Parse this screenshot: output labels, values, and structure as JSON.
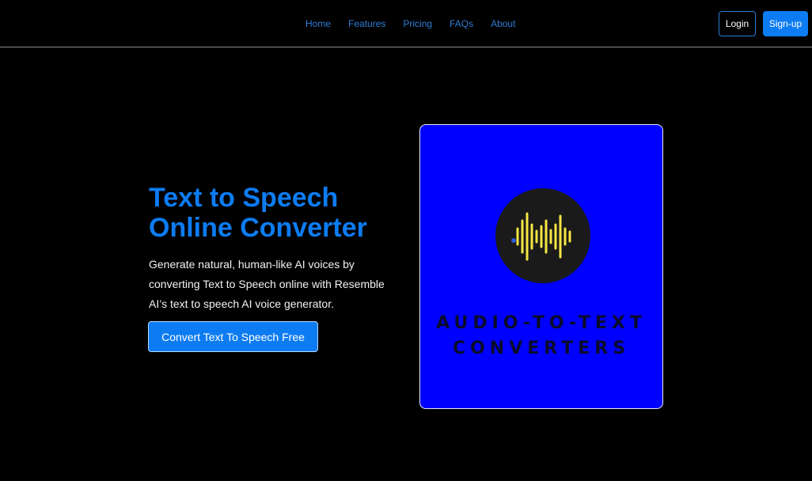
{
  "nav": {
    "links": [
      "Home",
      "Features",
      "Pricing",
      "FAQs",
      "About"
    ],
    "login_label": "Login",
    "signup_label": "Sign-up"
  },
  "hero": {
    "title_line1": "Text to Speech",
    "title_line2": "Online Converter",
    "description": "Generate natural, human-like AI voices by converting Text to Speech online with Resemble AI’s text to speech AI voice generator.",
    "cta_label": "Convert Text To Speech Free"
  },
  "logo": {
    "line1": "AUDIO-TO-TEXT",
    "line2": "CONVERTERS",
    "icon": "sound-wave-icon"
  },
  "colors": {
    "background": "#000000",
    "accent": "#0d7cf2",
    "nav_link": "#2f7dd6",
    "card_background": "#0000ff",
    "wave": "#f5e642"
  }
}
